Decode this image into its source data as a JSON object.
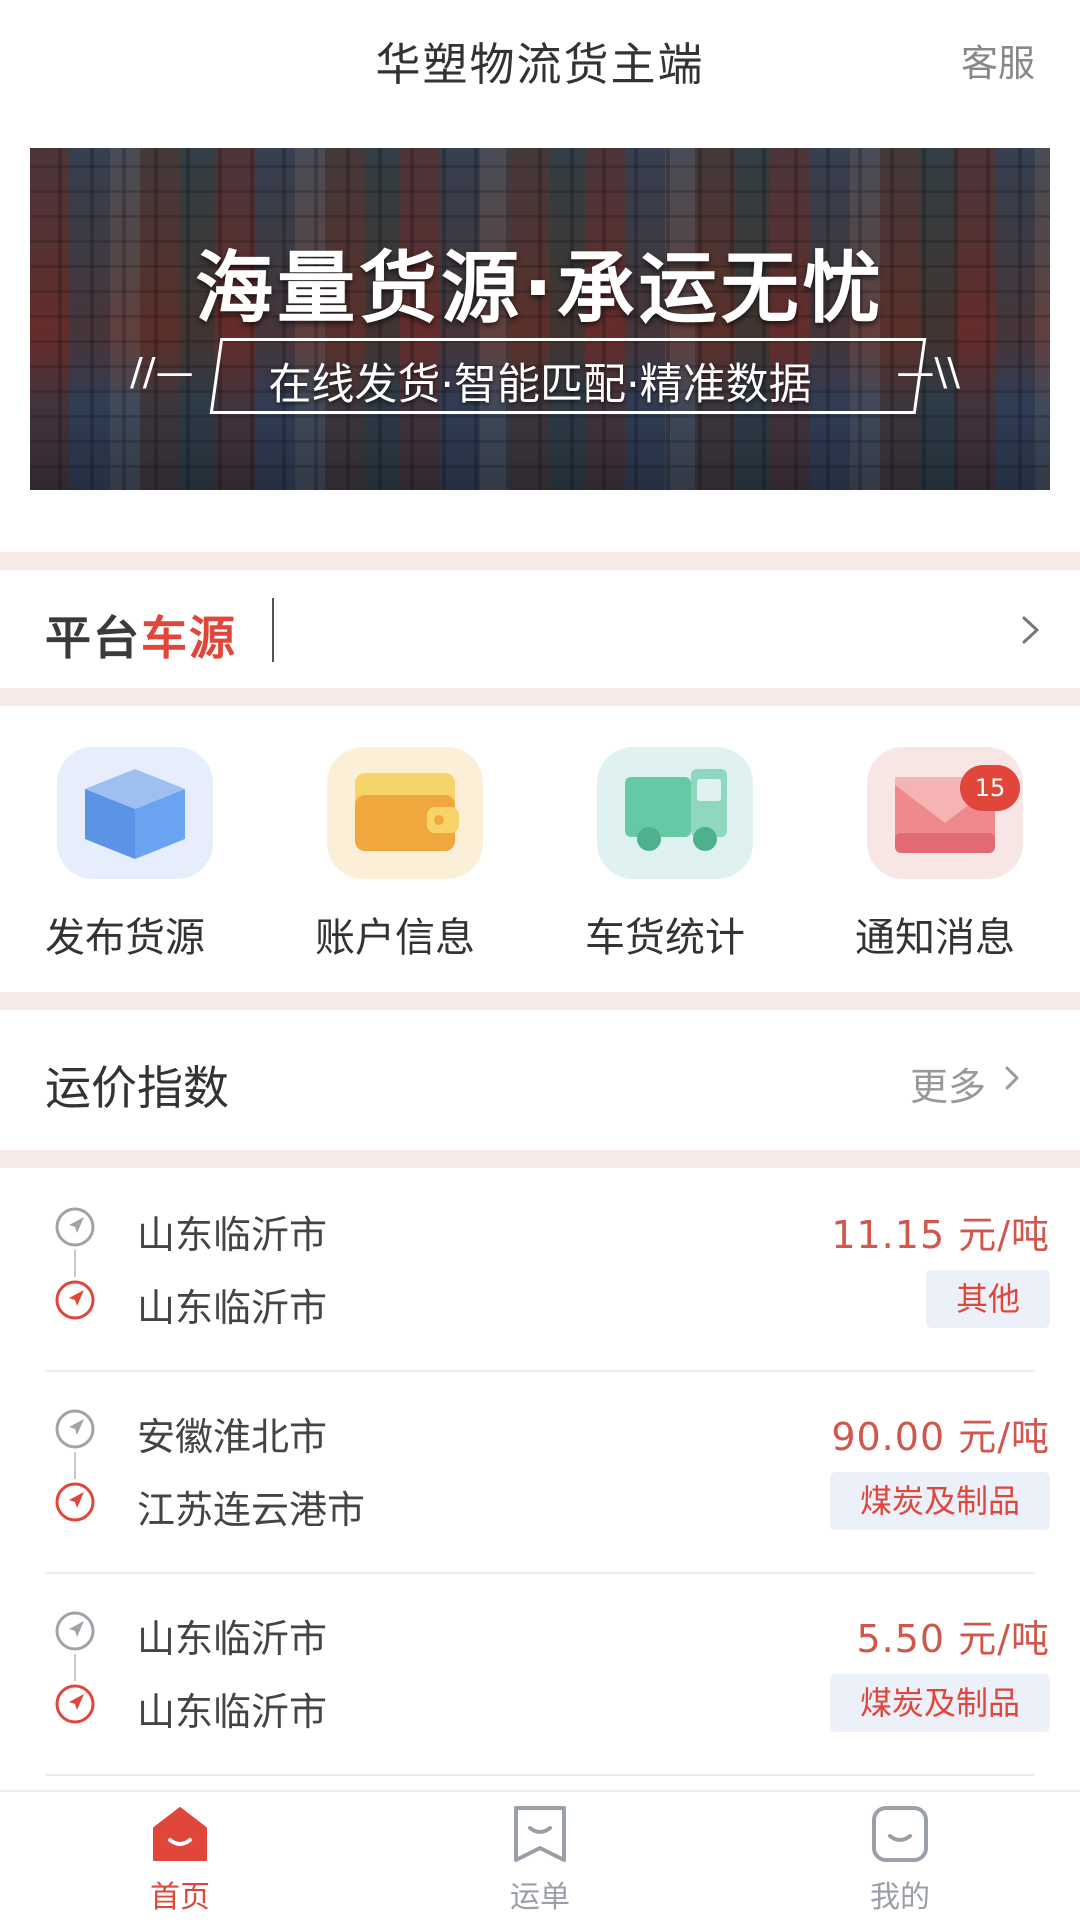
{
  "header": {
    "title": "华塑物流货主端",
    "customer_service": "客服"
  },
  "banner": {
    "headline": "海量货源·承运无忧",
    "subline": "在线发货·智能匹配·精准数据",
    "deco_left": "//—",
    "deco_right": "—\\\\"
  },
  "platform": {
    "logo_part1": "平台",
    "logo_part2": "车源"
  },
  "actions": [
    {
      "label": "发布货源",
      "icon": "cube-icon"
    },
    {
      "label": "账户信息",
      "icon": "wallet-icon"
    },
    {
      "label": "车货统计",
      "icon": "truck-icon"
    },
    {
      "label": "通知消息",
      "icon": "envelope-icon",
      "badge": "15"
    }
  ],
  "freight_index": {
    "title": "运价指数",
    "more": "更多"
  },
  "routes": [
    {
      "from": "山东临沂市",
      "to": "山东临沂市",
      "price": "11.15 元/吨",
      "cargo": "其他"
    },
    {
      "from": "安徽淮北市",
      "to": "江苏连云港市",
      "price": "90.00 元/吨",
      "cargo": "煤炭及制品"
    },
    {
      "from": "山东临沂市",
      "to": "山东临沂市",
      "price": "5.50 元/吨",
      "cargo": "煤炭及制品"
    }
  ],
  "tabbar": {
    "items": [
      {
        "label": "首页",
        "active": true
      },
      {
        "label": "运单",
        "active": false
      },
      {
        "label": "我的",
        "active": false
      }
    ]
  },
  "colors": {
    "accent": "#e0463a",
    "price": "#d0574d",
    "separator": "#f6e9e6",
    "inactive_tab": "#9aa0a8"
  }
}
